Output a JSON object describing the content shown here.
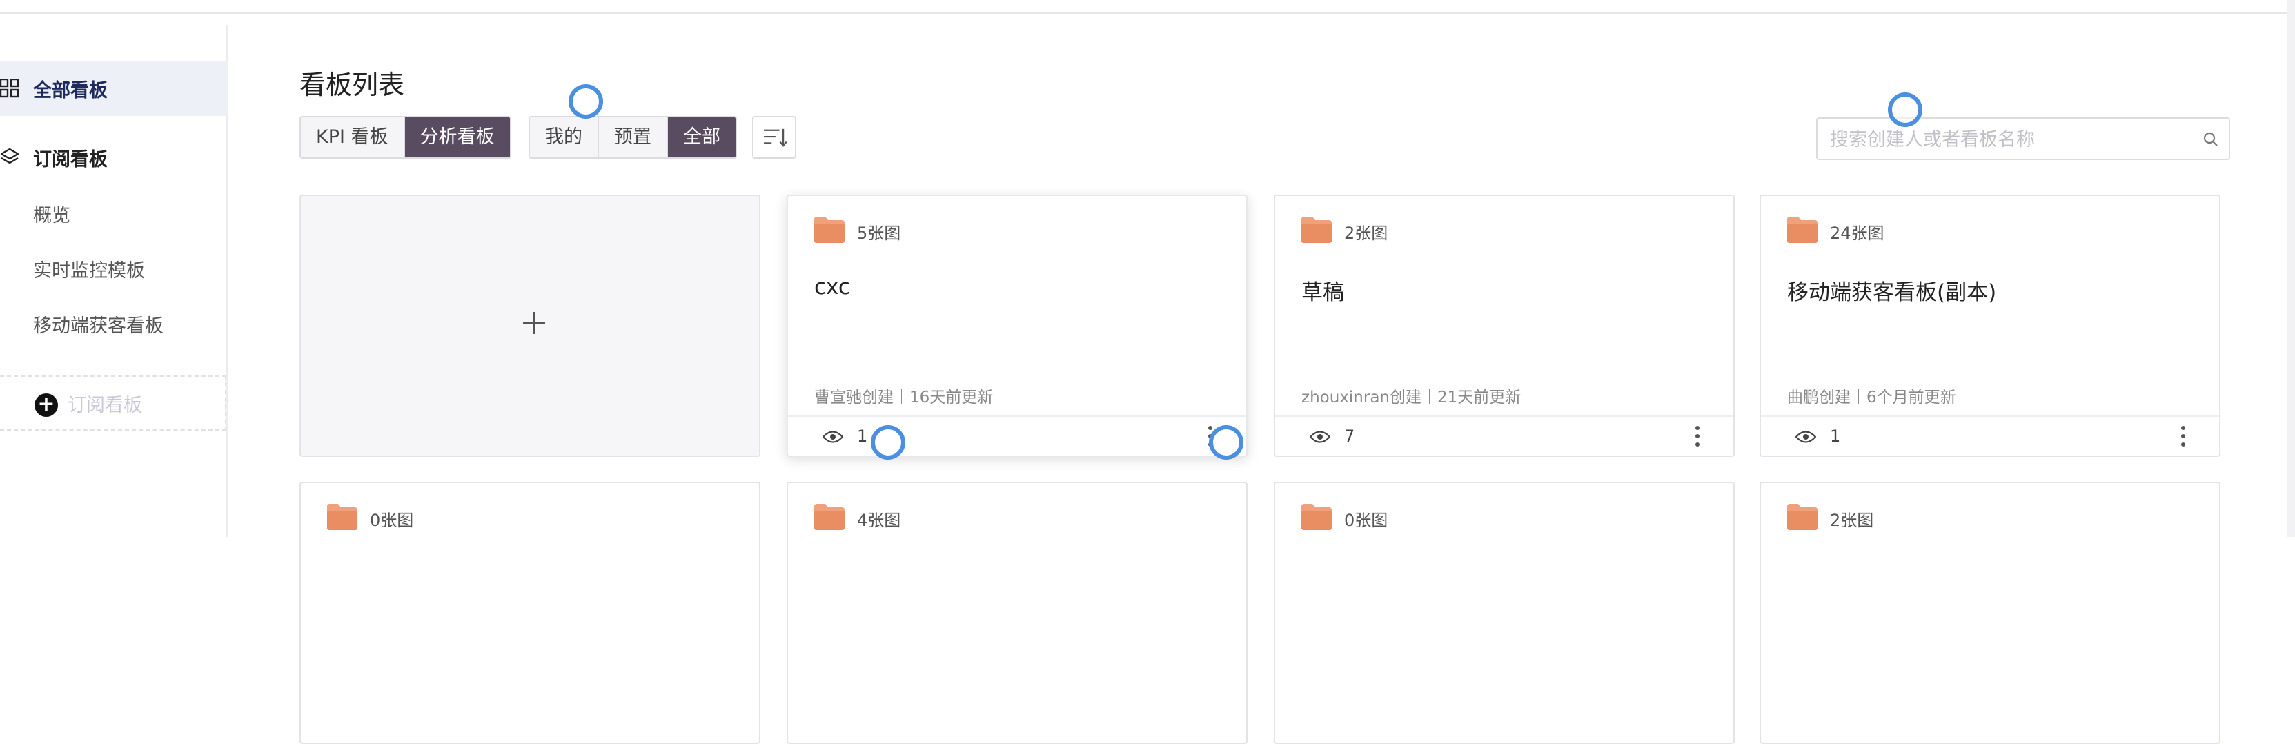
{
  "sidebar": {
    "all_boards": "全部看板",
    "subscribed": "订阅看板",
    "sub_items": [
      "概览",
      "实时监控模板",
      "移动端获客看板"
    ],
    "add_subscription": "订阅看板"
  },
  "main": {
    "title": "看板列表",
    "type_tabs": [
      "KPI 看板",
      "分析看板"
    ],
    "type_selected": "分析看板",
    "scope_tabs": [
      "我的",
      "预置",
      "全部"
    ],
    "scope_selected": "全部",
    "search_placeholder": "搜索创建人或者看板名称",
    "cards_row1": [
      {
        "count": "5张图",
        "name": "cxc",
        "meta": "曹宣驰创建｜16天前更新",
        "views": "1"
      },
      {
        "count": "2张图",
        "name": "草稿",
        "meta": "zhouxinran创建｜21天前更新",
        "views": "7"
      },
      {
        "count": "24张图",
        "name": "移动端获客看板(副本)",
        "meta": "曲鹏创建｜6个月前更新",
        "views": "1"
      }
    ],
    "cards_row2": [
      {
        "count": "0张图"
      },
      {
        "count": "4张图"
      },
      {
        "count": "0张图"
      },
      {
        "count": "2张图"
      }
    ]
  },
  "colors": {
    "accent_dark": "#5a4c60",
    "folder": "#f0a07a",
    "sidebar_active_bg": "#eef0f8",
    "touch_indicator": "#4a8fe0"
  }
}
